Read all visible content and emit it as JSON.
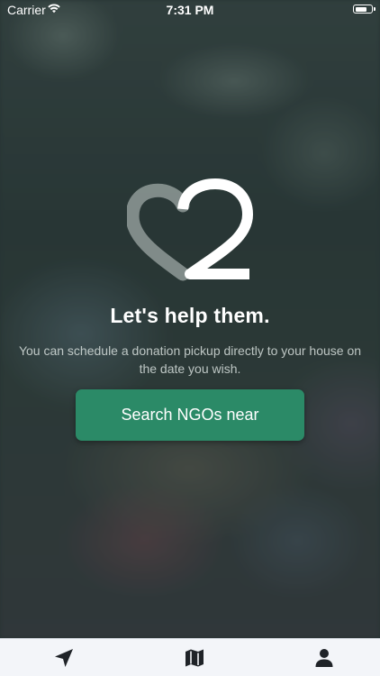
{
  "status_bar": {
    "carrier": "Carrier",
    "time": "7:31 PM"
  },
  "logo": {
    "icon": "heart-2-logo-icon"
  },
  "main": {
    "title": "Let's help them.",
    "subtitle": "You can schedule a donation pickup directly to your house on the date you wish.",
    "cta_label": "Search NGOs near"
  },
  "tab_bar": {
    "items": [
      {
        "icon": "navigation-arrow-icon"
      },
      {
        "icon": "map-icon"
      },
      {
        "icon": "user-icon"
      }
    ]
  },
  "colors": {
    "accent": "#2b8a67",
    "tab_bar_background": "#f3f5f9",
    "tab_icon": "#1f2328"
  }
}
